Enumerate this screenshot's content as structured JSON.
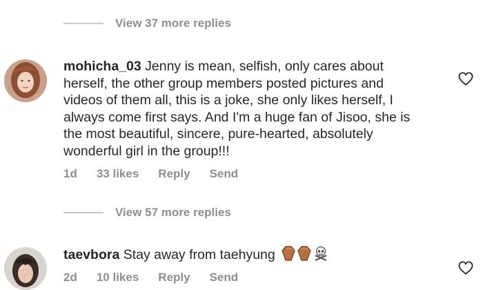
{
  "replies_top": {
    "label": "View 37 more replies"
  },
  "comment1": {
    "username": "mohicha_03",
    "text": "Jenny is mean, selfish, only cares about herself, the other group members posted pictures and videos of them all, this is a joke, she only likes herself, I always come first says. And I'm a huge fan of Jisoo, she is the most beautiful, sincere, pure-hearted, absolutely wonderful girl in the group!!!",
    "time": "1d",
    "likes": "33 likes",
    "reply": "Reply",
    "send": "Send"
  },
  "replies_mid": {
    "label": "View 57 more replies"
  },
  "comment2": {
    "username": "taevbora",
    "text": "Stay away from taehyung",
    "emojis": [
      "coffin-emoji",
      "coffin-emoji",
      "skull-crossbones-emoji"
    ],
    "time": "2d",
    "likes": "10 likes",
    "reply": "Reply",
    "send": "Send"
  },
  "icons": {
    "heart": "heart-outline-icon"
  },
  "colors": {
    "text": "#262626",
    "muted": "#8e8e8e",
    "divider": "#c7c7c7"
  }
}
